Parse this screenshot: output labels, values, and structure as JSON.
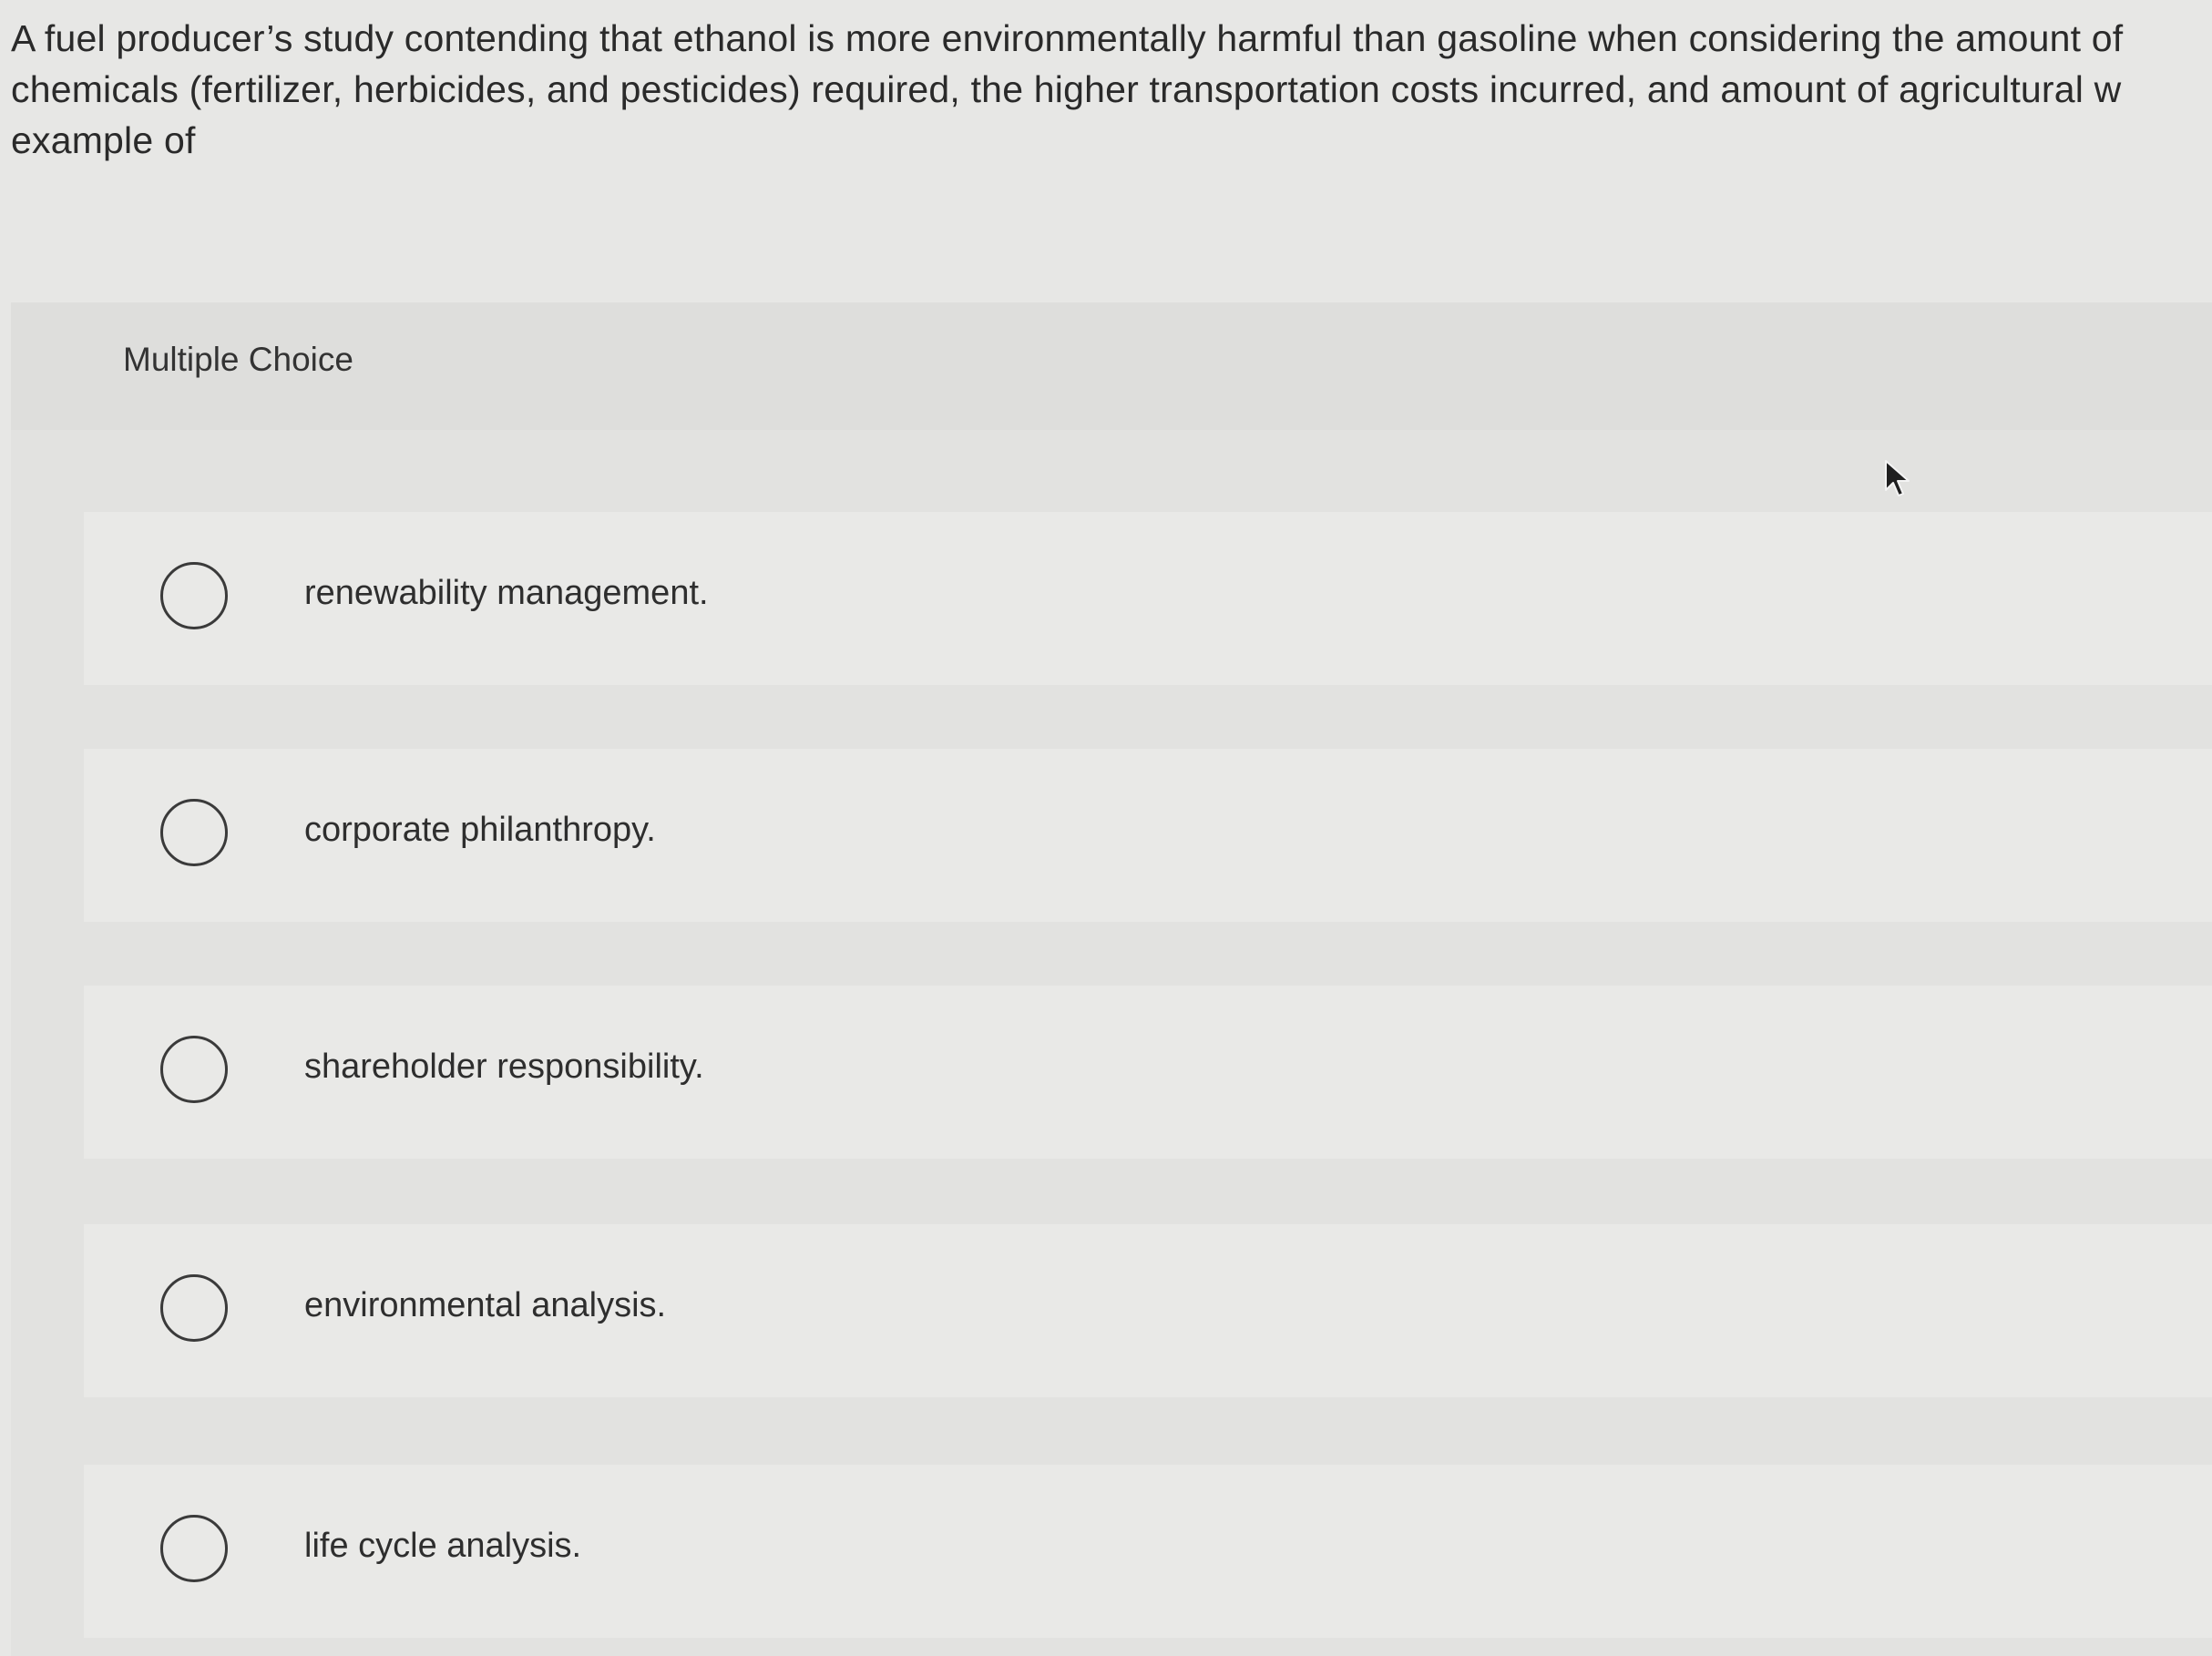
{
  "question": {
    "lines": [
      "A fuel producer’s study contending that ethanol is more environmentally harmful than gasoline when considering the amount of",
      "chemicals (fertilizer, herbicides, and pesticides) required, the higher transportation costs incurred, and amount of agricultural w",
      "example of"
    ]
  },
  "multiple_choice": {
    "header_label": "Multiple Choice",
    "options": [
      {
        "label": "renewability management.",
        "selected": false
      },
      {
        "label": "corporate philanthropy.",
        "selected": false
      },
      {
        "label": "shareholder responsibility.",
        "selected": false
      },
      {
        "label": "environmental analysis.",
        "selected": false
      },
      {
        "label": "life cycle analysis.",
        "selected": false
      }
    ]
  },
  "icons": {
    "radio": "radio-button-icon",
    "cursor": "mouse-pointer-icon"
  }
}
